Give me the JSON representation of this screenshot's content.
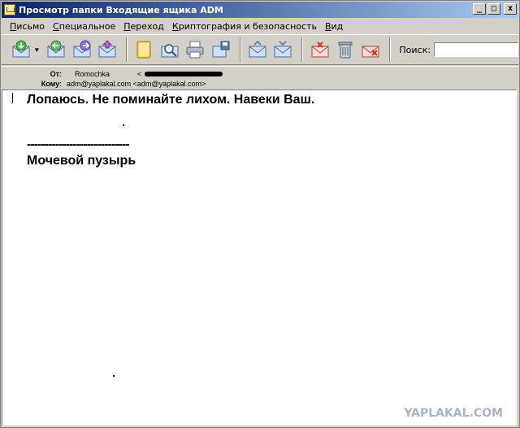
{
  "window": {
    "title": "Просмотр папки Входящие ящика ADM",
    "buttons": [
      "_",
      "□",
      "x"
    ]
  },
  "menu": [
    "Письмо",
    "Специальное",
    "Переход",
    "Криптография и безопасность",
    "Вид"
  ],
  "toolbar": {
    "icons": [
      "get-mail-icon",
      "reply-icon",
      "forward-icon",
      "send-icon",
      "address-book-icon",
      "search-mail-icon",
      "print-icon",
      "save-icon",
      "prev-icon",
      "next-icon",
      "mark-icon",
      "delete-icon",
      "junk-icon"
    ],
    "search_label": "Поиск:",
    "search_value": ""
  },
  "header": {
    "from_label": "От:",
    "from_name": "Romochka",
    "from_addr_open": "<",
    "to_label": "Кому:",
    "to_value": "adm@yaplakal.com <adm@yaplakal.com>"
  },
  "message": {
    "line1": "Лопаюсь. Не поминайте лихом.  Навеки Ваш.",
    "dashes": "-----------------------------",
    "signature": "Мочевой пузырь"
  },
  "watermark": "YAPLAKAL.COM",
  "colors": {
    "title_gradient_start": "#0a246a",
    "title_gradient_end": "#a6caf0",
    "chrome": "#d4d0c8",
    "watermark": "#a8b4c8"
  }
}
